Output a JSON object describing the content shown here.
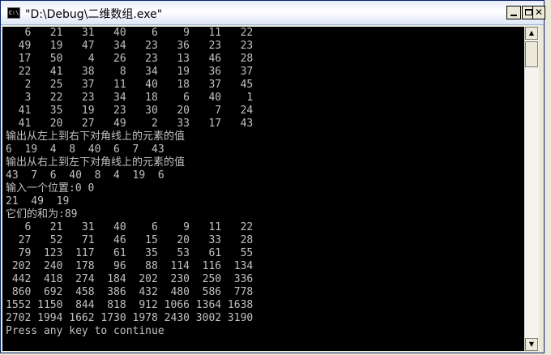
{
  "window": {
    "title": "\"D:\\Debug\\二维数组.exe\"",
    "icon_name": "console-app-icon",
    "icon_text": "C:\\"
  },
  "colors": {
    "console_bg": "#000000",
    "console_text": "#C0C0C0",
    "titlebar": "#FFFFFF",
    "chrome": "#ECE9D8"
  },
  "console": {
    "lines": [
      "   6   21   31   40    6    9   11   22",
      "  49   19   47   34   23   36   23   23",
      "  17   50    4   26   23   13   46   28",
      "  22   41   38    8   34   19   36   37",
      "   2   25   37   11   40   18   37   45",
      "   3   22   23   34   18    6   40    1",
      "  41   35   19   23   30   20    7   24",
      "  41   20   27   49    2   33   17   43",
      "输出从左上到右下对角线上的元素的值",
      "6  19  4  8  40  6  7  43",
      "输出从右上到左下对角线上的元素的值",
      "43  7  6  40  8  4  19  6",
      "输入一个位置:0 0",
      "21  49  19",
      "它们的和为:89",
      "   6   21   31   40    6    9   11   22",
      "  27   52   71   46   15   20   33   28",
      "  79  123  117   61   35   53   61   55",
      " 202  240  178   96   88  114  116  134",
      " 442  418  274  184  202  230  250  336",
      " 860  692  458  386  432  480  586  778",
      "1552 1150  844  818  912 1066 1364 1638",
      "2702 1994 1662 1730 1978 2430 3002 3190",
      "Press any key to continue"
    ]
  },
  "scrollbar": {
    "up_arrow": "▲",
    "down_arrow": "▼"
  }
}
